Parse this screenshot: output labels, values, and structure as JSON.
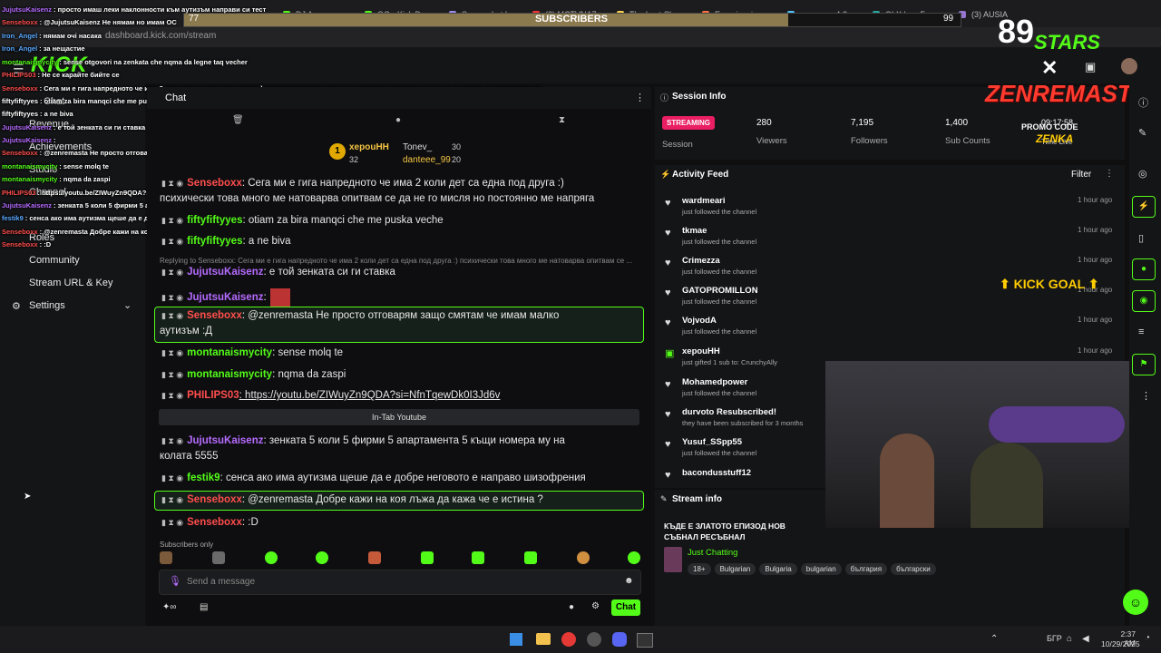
{
  "browser": {
    "url": "dashboard.kick.com/stream",
    "tabs": [
      "DJ Avayay",
      "OG - Kick Da",
      "Screenshot h",
      "(2) MCTVNA7",
      "The best Char",
      "Experiencing",
      "двигател 4.8",
      "OLX.bg - Без",
      "(3) AUSIA"
    ]
  },
  "subs_goal": {
    "label": "SUBSCRIBERS",
    "current": "77",
    "target": "99",
    "progress": 0.78
  },
  "overlay": {
    "stars_count": "89",
    "stars_word": "STARS",
    "channel_logo": "ZENREMASTA",
    "promo_label": "PROMO CODE",
    "promo_code": "ZENKA",
    "time": "09:17:58",
    "time_sub": "Time Live",
    "kick_goal": "KICK GOAL",
    "chat_lines": [
      {
        "user": "JujutsuKaisenz",
        "color": "#b66bff",
        "text": ": просто имаш леки наклонности към аутизъм направи си тест"
      },
      {
        "user": "Senseboxx",
        "color": "#ff4d4d",
        "text": ": @JujutsuKaisenz Не нямам но имам ОС"
      },
      {
        "user": "Iron_Angel",
        "color": "#5aa9ff",
        "text": ": нямам очі насака"
      },
      {
        "user": "Iron_Angel",
        "color": "#5aa9ff",
        "text": ": за нещастие"
      },
      {
        "user": "montanaismycity",
        "color": "#53fc18",
        "text": ": sense otgovori na zenkata che nqma da legne taq vecher"
      },
      {
        "user": "PHILIPS03",
        "color": "#ff4d4d",
        "text": ": Не се карайте бийте се"
      },
      {
        "user": "Senseboxx",
        "color": "#ff4d4d",
        "text": ": Сега ми е гига напредното че има 2 коли дет са една под друга :) психически това много ме натоварва опитвам се да не го мисля но постоянно ме"
      },
      {
        "user": "fiftyfiftyyes",
        "color": "#ffffff",
        "text": ": otiam za bira manqci che me puska veche"
      },
      {
        "user": "fiftyfiftyyes",
        "color": "#ffffff",
        "text": ": a ne biva"
      },
      {
        "user": "JujutsuKaisenz",
        "color": "#b66bff",
        "text": ": е той зенката си ги ставка"
      },
      {
        "user": "JujutsuKaisenz",
        "color": "#b66bff",
        "text": ":"
      },
      {
        "user": "Senseboxx",
        "color": "#ff4d4d",
        "text": ": @zenremasta Не просто отговарям защо смятам че имам малко аутизъм :Д"
      },
      {
        "user": "montanaismycity",
        "color": "#53fc18",
        "text": ": sense molq te"
      },
      {
        "user": "montanaismycity",
        "color": "#53fc18",
        "text": ": nqma da zaspi"
      },
      {
        "user": "PHILIPS03",
        "color": "#ff4d4d",
        "text": ": https://youtu.be/ZIWuyZn9QDA?si=NfnTqewDk0I3Jd6v"
      },
      {
        "user": "JujutsuKaisenz",
        "color": "#b66bff",
        "text": ": зенката 5 коли 5 фирми 5 апартамента 5 къщи номера му на колата 5555"
      },
      {
        "user": "festik9",
        "color": "#5aa9ff",
        "text": ": сенса ако има аутизма щеше да е добре неговото е направо шизофрения"
      },
      {
        "user": "Senseboxx",
        "color": "#ff4d4d",
        "text": ": @zenremasta Добре кажи на коя лъжа да кажа че е истина ?"
      },
      {
        "user": "Senseboxx",
        "color": "#ff4d4d",
        "text": ": :D"
      }
    ]
  },
  "nav": {
    "items": [
      "Chat",
      "Revenue",
      "Achievements",
      "Studio",
      "Channel",
      "Roles",
      "Community",
      "Stream URL & Key",
      "Settings"
    ]
  },
  "chat": {
    "header": "Chat",
    "gifters": [
      {
        "name": "xepouHH",
        "count": "32"
      },
      {
        "name": "Tonev_",
        "count": "30"
      },
      {
        "name": "danteee_99",
        "count": "20"
      }
    ],
    "reply_hint": "Replying to Senseboxx: Сега ми е гига напредното че има 2 коли дет са една под друга :) психически това много ме натоварва опитвам се ...",
    "messages": [
      {
        "user": "Senseboxx",
        "color": "#ff4d4d",
        "text": ": Сега ми е гига напредното че има 2 коли дет са една под друга :)"
      },
      {
        "user": "",
        "color": "#e6e6e6",
        "text": "психически това много ме натоварва опитвам се да не го мисля но постоянно ме напряга"
      },
      {
        "user": "fiftyfiftyyes",
        "color": "#53fc18",
        "text": ": otiam za bira manqci che me puska veche"
      },
      {
        "user": "fiftyfiftyyes",
        "color": "#53fc18",
        "text": ": a ne biva"
      },
      {
        "user": "JujutsuKaisenz",
        "color": "#b66bff",
        "text": ": е той зенката си ги ставка"
      },
      {
        "user": "JujutsuKaisenz",
        "color": "#b66bff",
        "text": ":"
      },
      {
        "user": "Senseboxx",
        "color": "#ff4d4d",
        "text": ": @zenremasta Не просто отговарям защо смятам че имам малко"
      },
      {
        "user": "",
        "color": "#e6e6e6",
        "text": "аутизъм :Д"
      },
      {
        "user": "montanaismycity",
        "color": "#53fc18",
        "text": ": sense molq te"
      },
      {
        "user": "montanaismycity",
        "color": "#53fc18",
        "text": ": nqma da zaspi"
      },
      {
        "user": "PHILIPS03",
        "color": "#ff4d4d",
        "text": ": https://youtu.be/ZIWuyZn9QDA?si=NfnTqewDk0I3Jd6v"
      },
      {
        "user": "JujutsuKaisenz",
        "color": "#b66bff",
        "text": ": зенката 5 коли 5 фирми 5 апартамента 5 къщи номера му на"
      },
      {
        "user": "",
        "color": "#e6e6e6",
        "text": "колата 5555"
      },
      {
        "user": "festik9",
        "color": "#53fc18",
        "text": ": сенса ако има аутизма щеше да е добре неговото е направо шизофрения"
      },
      {
        "user": "Senseboxx",
        "color": "#ff4d4d",
        "text": ": @zenremasta Добре кажи на коя лъжа да кажа че е истина ?"
      },
      {
        "user": "Senseboxx",
        "color": "#ff4d4d",
        "text": ": :D"
      }
    ],
    "youtube_button": "In-Tab Youtube",
    "subscribers_only": "Subscribers only",
    "input_placeholder": "Send a message",
    "send_label": "Chat"
  },
  "session": {
    "title": "Session Info",
    "status": "STREAMING",
    "status_label": "Session",
    "stats": [
      {
        "value": "280",
        "label": "Viewers"
      },
      {
        "value": "7,195",
        "label": "Followers"
      },
      {
        "value": "1,400",
        "label": "Sub Counts"
      }
    ]
  },
  "activity": {
    "title": "Activity Feed",
    "filter": "Filter",
    "items": [
      {
        "name": "wardmeari",
        "sub": "just followed the channel",
        "time": "1 hour ago",
        "icon": "heart-icon"
      },
      {
        "name": "tkmae",
        "sub": "just followed the channel",
        "time": "1 hour ago",
        "icon": "heart-icon"
      },
      {
        "name": "Crimezza",
        "sub": "just followed the channel",
        "time": "1 hour ago",
        "icon": "heart-icon"
      },
      {
        "name": "GATOPROMILLON",
        "sub": "just followed the channel",
        "time": "1 hour ago",
        "icon": "heart-icon"
      },
      {
        "name": "VojvodA",
        "sub": "just followed the channel",
        "time": "1 hour ago",
        "icon": "heart-icon"
      },
      {
        "name": "xepouHH",
        "sub": "just gifted 1 sub to: CrunchyAlly",
        "time": "1 hour ago",
        "icon": "gift-icon"
      },
      {
        "name": "Mohamedpower",
        "sub": "just followed the channel",
        "time": "",
        "icon": "heart-icon"
      },
      {
        "name": "durvoto Resubscribed!",
        "sub": "they have been subscribed for 3 months",
        "time": "",
        "icon": "heart-icon"
      },
      {
        "name": "Yusuf_SSpp55",
        "sub": "just followed the channel",
        "time": "",
        "icon": "heart-icon"
      },
      {
        "name": "bacondusstuff12",
        "sub": "",
        "time": "",
        "icon": "heart-icon"
      }
    ]
  },
  "stream_info": {
    "title": "Stream info",
    "stream_title": "КЪДЕ Е ЗЛАТОТО ЕПИЗОД НОВ СЪБНАЛ РЕСЪБНАЛ",
    "category": "Just Chatting",
    "tags": [
      "18+",
      "Bulgarian",
      "Bulgaria",
      "bulgarian",
      "българия",
      "български"
    ]
  },
  "taskbar": {
    "lang": "БГР",
    "time": "2:37 AM",
    "date": "10/29/2025"
  },
  "colors": {
    "accent": "#53fc18",
    "streaming": "#e91e63"
  }
}
